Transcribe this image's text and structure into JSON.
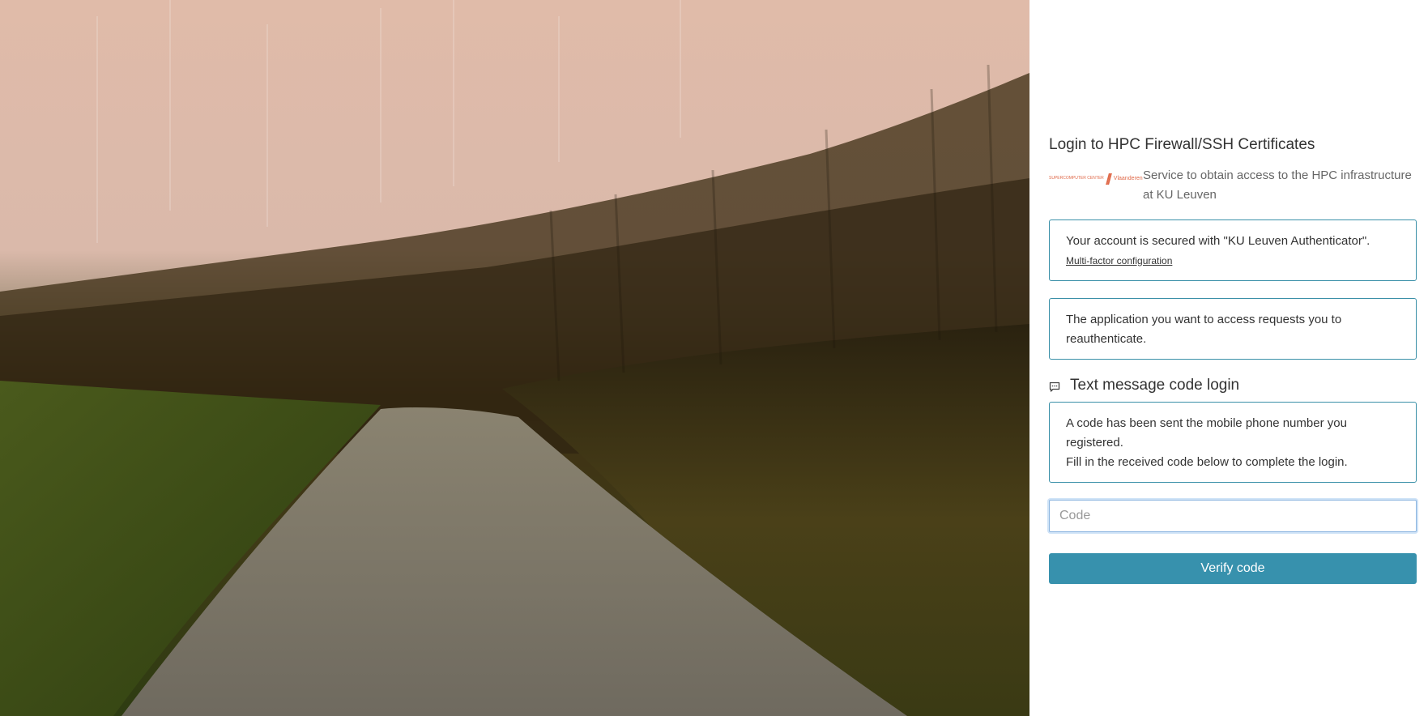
{
  "login": {
    "title": "Login to HPC Firewall/SSH Certificates",
    "service_description": "Service to obtain access to the HPC infrastructure at KU Leuven",
    "logo_text_left": "SUPERCOMPUTER CENTER",
    "logo_text_right": "Vlaanderen"
  },
  "account_notice": {
    "text": "Your account is secured with \"KU Leuven Authenticator\".",
    "link_label": "Multi-factor configuration"
  },
  "reauth_notice": {
    "text": "The application you want to access requests you to reauthenticate."
  },
  "sms_section": {
    "title": "Text message code login",
    "icon": "chat-icon",
    "info_line1": "A code has been sent the mobile phone number you registered.",
    "info_line2": "Fill in the received code below to complete the login."
  },
  "code_input": {
    "placeholder": "Code",
    "value": ""
  },
  "verify_button": {
    "label": "Verify code"
  },
  "colors": {
    "accent": "#3791ad",
    "border": "#3a90a8",
    "logo": "#e06a4a"
  }
}
